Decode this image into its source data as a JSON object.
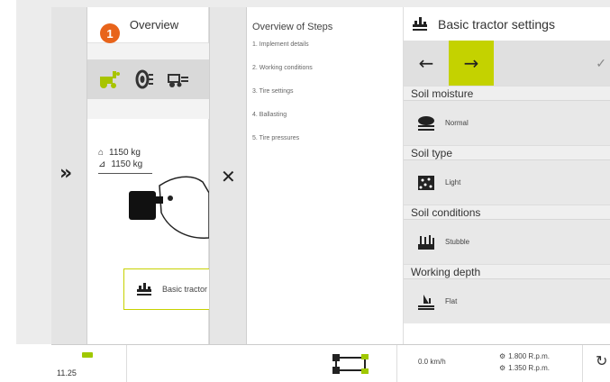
{
  "overview": {
    "title": "Overview",
    "badge": "1",
    "weight_front": "1150 kg",
    "weight_rear": "1150 kg",
    "basic_button": "Basic tractor set"
  },
  "steps": {
    "title": "Overview of Steps",
    "items": [
      "1. Implement details",
      "2. Working conditions",
      "3. Tire settings",
      "4. Ballasting",
      "5. Tire pressures"
    ]
  },
  "settings": {
    "title": "Basic tractor settings",
    "back_icon": "←",
    "forward_icon": "→",
    "sections": [
      {
        "label": "Soil moisture",
        "value": "Normal",
        "icon": "soil-moisture-icon"
      },
      {
        "label": "Soil type",
        "value": "Light",
        "icon": "soil-type-icon"
      },
      {
        "label": "Soil conditions",
        "value": "Stubble",
        "icon": "stubble-icon"
      },
      {
        "label": "Working depth",
        "value": "Flat",
        "icon": "working-depth-icon"
      }
    ]
  },
  "statusbar": {
    "time": "11.25",
    "speed": "0.0 km/h",
    "rpm1": "1.800 R.p.m.",
    "rpm2": "1.350 R.p.m."
  },
  "colors": {
    "accent": "#c4d200",
    "badge": "#e8641b"
  }
}
